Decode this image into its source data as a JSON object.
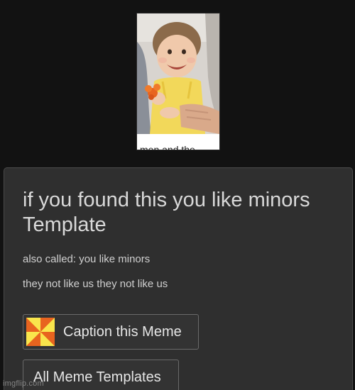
{
  "thumbnail": {
    "caption_text": "men and the"
  },
  "panel": {
    "title": "if you found this you like minors Template",
    "also_called": "also called: you like minors",
    "alias_2": "they not like us they not like us"
  },
  "buttons": {
    "caption_label": "Caption this Meme",
    "caption_icon": "pinwheel-icon",
    "all_templates_label": "All Meme Templates"
  },
  "watermark": "imgflip.com",
  "colors": {
    "background": "#121212",
    "panel": "#2f2f2f",
    "pinwheel_orange": "#f39c12",
    "pinwheel_yellow": "#f9e54c"
  }
}
